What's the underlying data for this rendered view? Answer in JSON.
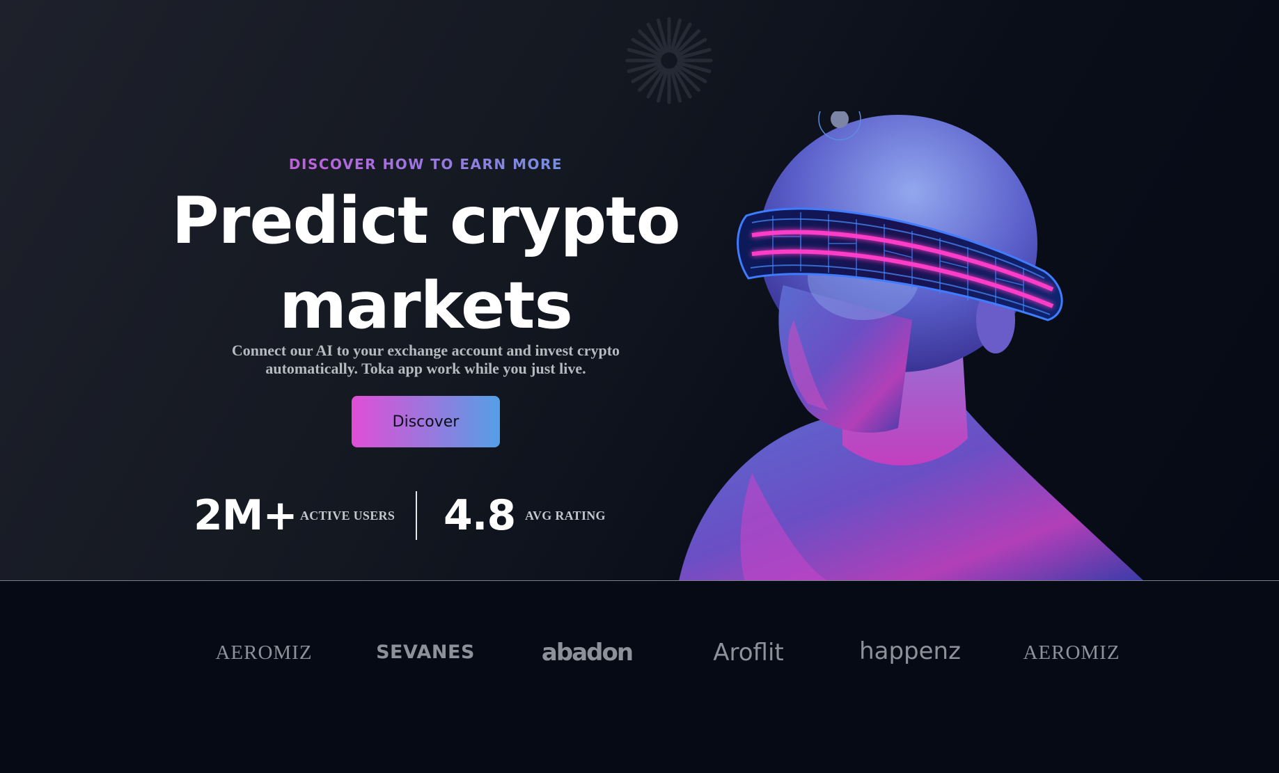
{
  "hero": {
    "eyebrow": "DISCOVER HOW TO EARN MORE",
    "headline": "Predict crypto markets",
    "subtitle": "Connect our AI to your exchange account and invest crypto automatically. Toka app work while you just live.",
    "cta_label": "Discover",
    "gradient_colors": [
      "#e04ed6",
      "#549fe6"
    ]
  },
  "stats": [
    {
      "value": "2M+",
      "label": "ACTIVE USERS"
    },
    {
      "value": "4.8",
      "label": "AVG RATING"
    }
  ],
  "logos": [
    "AEROMIZ",
    "SEVANES",
    "abadon",
    "Aroflit",
    "happenz",
    "AEROMIZ"
  ],
  "icons": {
    "decoration": "radial-burst-icon",
    "illustration": "vr-head-illustration"
  }
}
